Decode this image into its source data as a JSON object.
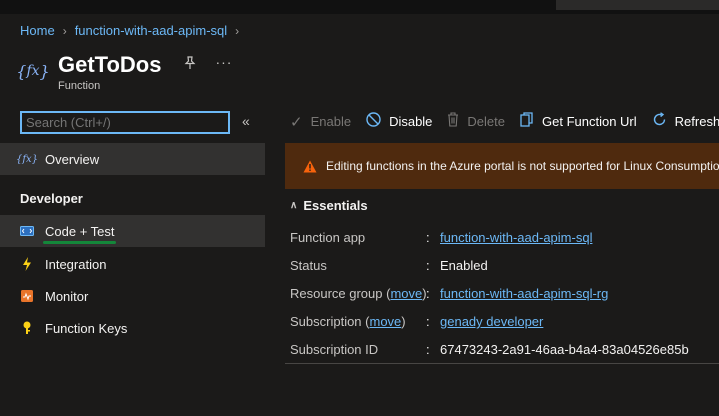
{
  "breadcrumb": [
    "Home",
    "function-with-aad-apim-sql"
  ],
  "header": {
    "title": "GetToDos",
    "subtitle": "Function",
    "icon": "function-icon"
  },
  "search": {
    "placeholder": "Search (Ctrl+/)",
    "value": ""
  },
  "nav": {
    "overview": "Overview",
    "section_developer": "Developer",
    "items": [
      {
        "label": "Code + Test",
        "icon": "code-icon"
      },
      {
        "label": "Integration",
        "icon": "lightning-icon"
      },
      {
        "label": "Monitor",
        "icon": "monitor-icon"
      },
      {
        "label": "Function Keys",
        "icon": "key-icon"
      }
    ]
  },
  "toolbar": {
    "enable": "Enable",
    "disable": "Disable",
    "delete": "Delete",
    "get_url": "Get Function Url",
    "refresh": "Refresh"
  },
  "warning": "Editing functions in the Azure portal is not supported for Linux Consumption Function Apps.",
  "essentials": {
    "header": "Essentials",
    "move_label": "move",
    "rows": [
      {
        "label": "Function app",
        "value": "function-with-aad-apim-sql"
      },
      {
        "label": "Status",
        "value": "Enabled"
      },
      {
        "label": "Resource group",
        "value": "function-with-aad-apim-sql-rg"
      },
      {
        "label": "Subscription",
        "value": "genady developer"
      },
      {
        "label": "Subscription ID",
        "value": "67473243-2a91-46aa-b4a4-83a04526e85b"
      }
    ]
  },
  "colors": {
    "accent": "#6cb8f6",
    "warning_bg": "#4f2a0e",
    "active_bg": "#323130",
    "green": "#14873a"
  }
}
